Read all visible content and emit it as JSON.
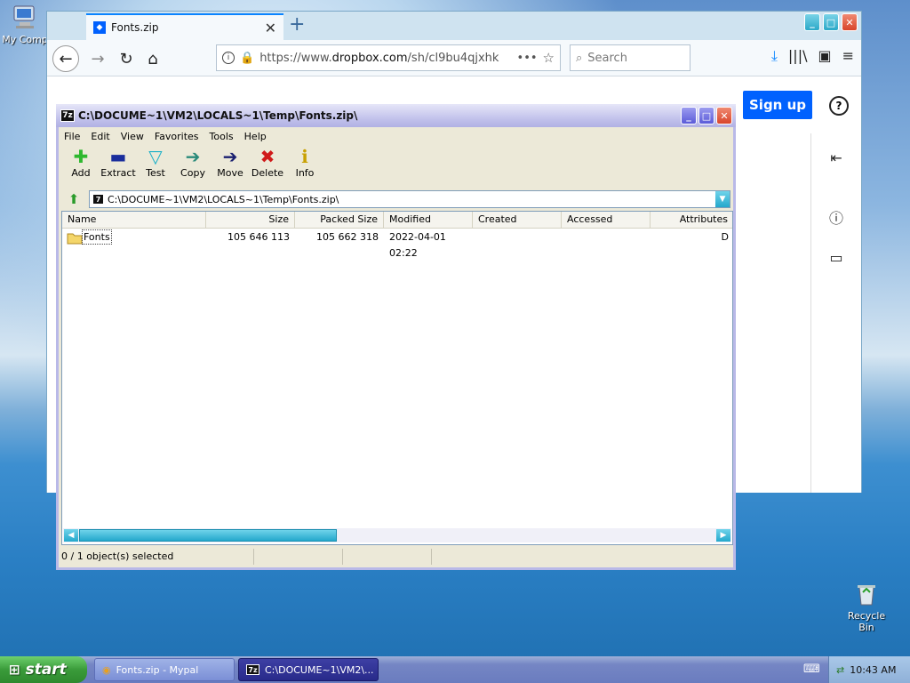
{
  "desktop": {
    "icons": [
      {
        "label": "My Comp"
      },
      {
        "label": "Recycle Bin"
      }
    ]
  },
  "firefox": {
    "tab_title": "Fonts.zip",
    "url_prefix": "https://www.",
    "url_domain": "dropbox.com",
    "url_path": "/sh/cl9bu4qjxhk",
    "search_placeholder": "Search",
    "signup_label": "Sign up"
  },
  "sevenzip": {
    "title": "C:\\DOCUME~1\\VM2\\LOCALS~1\\Temp\\Fonts.zip\\",
    "menu": [
      "File",
      "Edit",
      "View",
      "Favorites",
      "Tools",
      "Help"
    ],
    "toolbar": [
      {
        "label": "Add",
        "icon": "plus-icon",
        "glyph": "✚",
        "color": "#2eb82e"
      },
      {
        "label": "Extract",
        "icon": "minus-icon",
        "glyph": "▬",
        "color": "#1a2e9c"
      },
      {
        "label": "Test",
        "icon": "check-icon",
        "glyph": "▽",
        "color": "#1ab0c8"
      },
      {
        "label": "Copy",
        "icon": "copy-arrow-icon",
        "glyph": "➔",
        "color": "#2a8a7a"
      },
      {
        "label": "Move",
        "icon": "move-arrow-icon",
        "glyph": "➔",
        "color": "#1a2070"
      },
      {
        "label": "Delete",
        "icon": "delete-x-icon",
        "glyph": "✖",
        "color": "#d01a1a"
      },
      {
        "label": "Info",
        "icon": "info-icon",
        "glyph": "ℹ",
        "color": "#c8a000"
      }
    ],
    "address": "C:\\DOCUME~1\\VM2\\LOCALS~1\\Temp\\Fonts.zip\\",
    "columns": [
      "Name",
      "Size",
      "Packed Size",
      "Modified",
      "Created",
      "Accessed",
      "Attributes"
    ],
    "rows": [
      {
        "name": "Fonts",
        "size": "105 646 113",
        "packed": "105 662 318",
        "modified": "2022-04-01 02:22",
        "created": "",
        "accessed": "",
        "attributes": "D"
      }
    ],
    "status": "0 / 1 object(s) selected"
  },
  "taskbar": {
    "start_label": "start",
    "tasks": [
      "Fonts.zip - Mypal",
      "C:\\DOCUME~1\\VM2\\..."
    ],
    "clock": "10:43 AM"
  }
}
